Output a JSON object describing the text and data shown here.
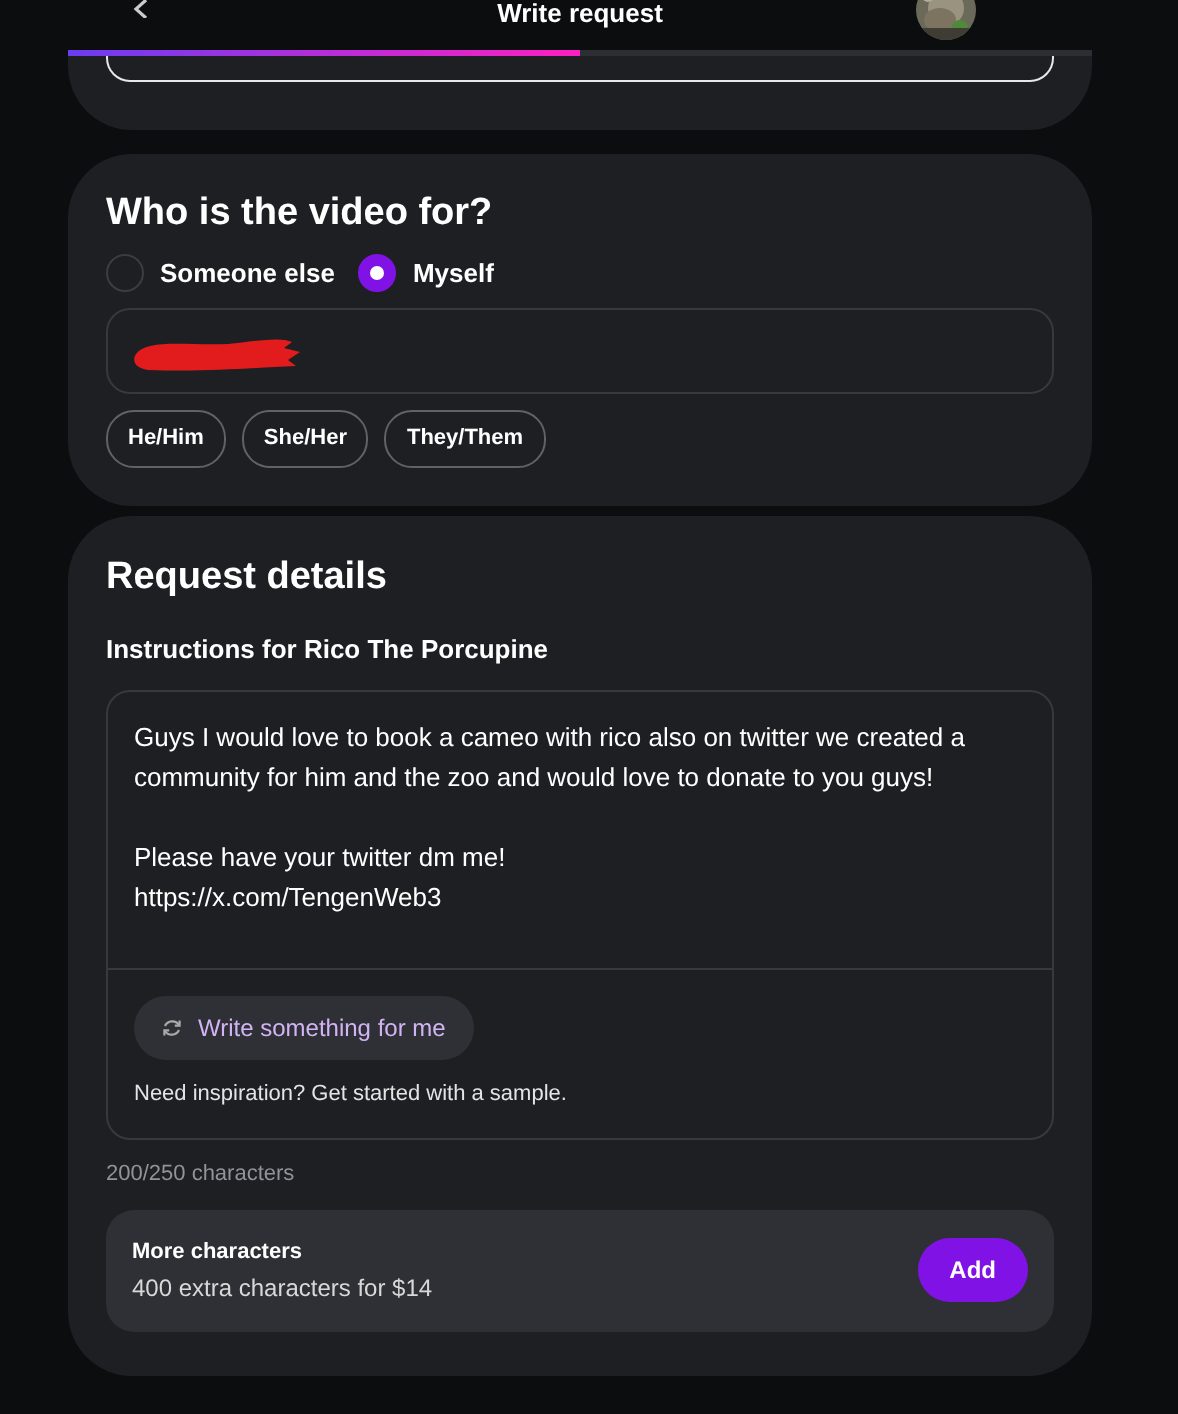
{
  "header": {
    "title": "Write request"
  },
  "progress": {
    "level": 0.5
  },
  "recipient": {
    "heading": "Who is the video for?",
    "options": [
      {
        "label": "Someone else",
        "selected": false
      },
      {
        "label": "Myself",
        "selected": true
      }
    ],
    "name_redacted": true,
    "pronouns": [
      {
        "label": "He/Him",
        "selected": false
      },
      {
        "label": "She/Her",
        "selected": false
      },
      {
        "label": "They/Them",
        "selected": false
      }
    ]
  },
  "details": {
    "heading": "Request details",
    "label": "Instructions for Rico The Porcupine",
    "paragraphs": [
      "Guys I would love to book a cameo with rico also on twitter we created a community for him and the zoo and would love to donate to you guys!",
      "Please have your twitter dm me!\nhttps://x.com/TengenWeb3"
    ],
    "assist_button": "Write something for me",
    "assist_hint": "Need inspiration? Get started with a sample.",
    "counter": "200/250 characters",
    "upsell": {
      "title": "More characters",
      "subtitle": "400 extra characters for $14",
      "button": "Add"
    }
  }
}
